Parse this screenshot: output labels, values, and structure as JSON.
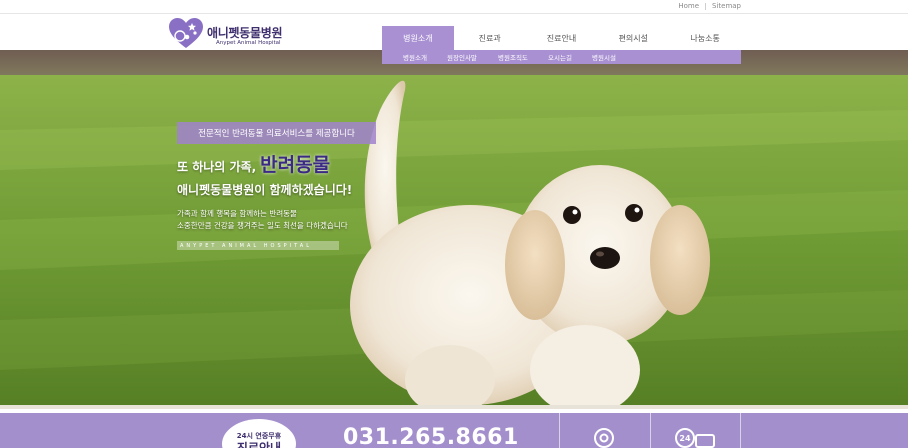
{
  "top_links": {
    "home": "Home",
    "sitemap": "Sitemap"
  },
  "logo": {
    "korean": "애니펫동물병원",
    "english": "Anypet Animal Hospital"
  },
  "gnb": [
    {
      "label": "병원소개",
      "active": true
    },
    {
      "label": "진료과",
      "active": false
    },
    {
      "label": "진료안내",
      "active": false
    },
    {
      "label": "편의시설",
      "active": false
    },
    {
      "label": "나눔소통",
      "active": false
    }
  ],
  "subnav": [
    "병원소개",
    "원장인사말",
    "병원조직도",
    "오시는길",
    "병원시설"
  ],
  "hero": {
    "slogan": "전문적인 반려동물 의료서비스를 제공합니다",
    "headline_part1": "또 하나의 가족,",
    "headline_part2": "반려동물",
    "headline_line2": "애니펫동물병원이 함께하겠습니다!",
    "desc_line1": "가족과 함께 행복을 함께하는 반려동물",
    "desc_line2": "소중한만큼 건강을 챙겨주는 일도 최선을 다하겠습니다",
    "tagline": "ANYPET ANIMAL HOSPITAL"
  },
  "footer": {
    "badge_line1": "24시 연중무휴",
    "badge_line2": "진료안내",
    "phone": "031.265.8661"
  },
  "colors": {
    "accent": "#a990d2",
    "footer_band": "#a48fcd",
    "logo_dark": "#3f2f6e",
    "headline_purple": "#3b2a85"
  },
  "icons": [
    "heart-paw-logo-icon",
    "target-icon",
    "24-hour-car-icon"
  ]
}
